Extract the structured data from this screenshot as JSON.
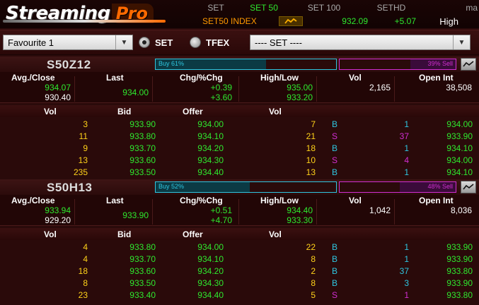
{
  "app": {
    "logo_main": "Streaming",
    "logo_pro": "Pro"
  },
  "index_bar": {
    "tabs": [
      {
        "label": "SET",
        "color": "#aaaaaa"
      },
      {
        "label": "SET 50",
        "color": "#2ee82e"
      },
      {
        "label": "SET 100",
        "color": "#aaaaaa"
      },
      {
        "label": "SETHD",
        "color": "#aaaaaa"
      },
      {
        "label": "ma",
        "color": "#aaaaaa"
      }
    ],
    "name": "SET50 INDEX",
    "trend_icon": "trend-icon",
    "last": "932.09",
    "change": "+5.07",
    "high_label": "High"
  },
  "controls": {
    "favourite_select": "Favourite 1",
    "radio_set": "SET",
    "radio_tfex": "TFEX",
    "market_select": "---- SET ----"
  },
  "headers": {
    "avg_close": "Avg./Close",
    "last": "Last",
    "chg": "Chg/%Chg",
    "high_low": "High/Low",
    "vol": "Vol",
    "open_int": "Open Int",
    "depth_vol": "Vol",
    "depth_bid": "Bid",
    "depth_offer": "Offer",
    "depth_vol2": "Vol"
  },
  "panels": [
    {
      "symbol": "S50Z12",
      "buy_label": "Buy   61%",
      "buy_pct": 61,
      "sell_label": "39%   Sell",
      "sell_pct": 39,
      "avg": "934.07",
      "close": "930.40",
      "last": "934.00",
      "chg": "+0.39",
      "pchg": "+3.60",
      "high": "935.00",
      "low": "933.20",
      "vol": "2,165",
      "open_int": "38,508",
      "rows": [
        {
          "bvol": "3",
          "bid": "933.90",
          "offer": "934.00",
          "ovol": "7",
          "side": "B",
          "qty": "1",
          "price": "934.00"
        },
        {
          "bvol": "11",
          "bid": "933.80",
          "offer": "934.10",
          "ovol": "21",
          "side": "S",
          "qty": "37",
          "price": "933.90"
        },
        {
          "bvol": "9",
          "bid": "933.70",
          "offer": "934.20",
          "ovol": "18",
          "side": "B",
          "qty": "1",
          "price": "934.10"
        },
        {
          "bvol": "13",
          "bid": "933.60",
          "offer": "934.30",
          "ovol": "10",
          "side": "S",
          "qty": "4",
          "price": "934.00"
        },
        {
          "bvol": "235",
          "bid": "933.50",
          "offer": "934.40",
          "ovol": "13",
          "side": "B",
          "qty": "1",
          "price": "934.10"
        }
      ]
    },
    {
      "symbol": "S50H13",
      "buy_label": "Buy   52%",
      "buy_pct": 52,
      "sell_label": "48%   Sell",
      "sell_pct": 48,
      "avg": "933.94",
      "close": "929.20",
      "last": "933.90",
      "chg": "+0.51",
      "pchg": "+4.70",
      "high": "934.40",
      "low": "933.30",
      "vol": "1,042",
      "open_int": "8,036",
      "rows": [
        {
          "bvol": "4",
          "bid": "933.80",
          "offer": "934.00",
          "ovol": "22",
          "side": "B",
          "qty": "1",
          "price": "933.90"
        },
        {
          "bvol": "4",
          "bid": "933.70",
          "offer": "934.10",
          "ovol": "8",
          "side": "B",
          "qty": "1",
          "price": "933.90"
        },
        {
          "bvol": "18",
          "bid": "933.60",
          "offer": "934.20",
          "ovol": "2",
          "side": "B",
          "qty": "37",
          "price": "933.80"
        },
        {
          "bvol": "8",
          "bid": "933.50",
          "offer": "934.30",
          "ovol": "8",
          "side": "B",
          "qty": "3",
          "price": "933.90"
        },
        {
          "bvol": "23",
          "bid": "933.40",
          "offer": "934.40",
          "ovol": "5",
          "side": "S",
          "qty": "1",
          "price": "933.80"
        }
      ]
    }
  ]
}
